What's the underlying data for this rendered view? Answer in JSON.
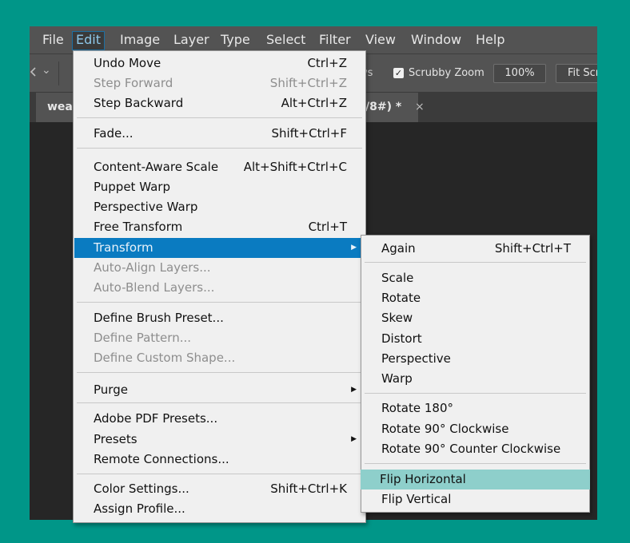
{
  "menubar": {
    "items": [
      "File",
      "Edit",
      "Image",
      "Layer",
      "Type",
      "Select",
      "Filter",
      "View",
      "Window",
      "Help"
    ],
    "active": "Edit"
  },
  "options": {
    "partial_left": "ws",
    "scrubby_zoom_label": "Scrubby Zoom",
    "scrubby_zoom_checked": true,
    "zoom_value": "100%",
    "fit_label": "Fit Scr"
  },
  "tab": {
    "title_start": "wea",
    "title_end": "/8#) *",
    "close": "×"
  },
  "edit_menu": {
    "items": [
      {
        "label": "Undo Move",
        "shortcut": "Ctrl+Z",
        "disabled": false
      },
      {
        "label": "Step Forward",
        "shortcut": "Shift+Ctrl+Z",
        "disabled": true
      },
      {
        "label": "Step Backward",
        "shortcut": "Alt+Ctrl+Z",
        "disabled": false
      },
      {
        "label": "Fade...",
        "shortcut": "Shift+Ctrl+F",
        "disabled": false
      },
      {
        "label": "Content-Aware Scale",
        "shortcut": "Alt+Shift+Ctrl+C",
        "disabled": false
      },
      {
        "label": "Puppet Warp",
        "shortcut": "",
        "disabled": false
      },
      {
        "label": "Perspective Warp",
        "shortcut": "",
        "disabled": false
      },
      {
        "label": "Free Transform",
        "shortcut": "Ctrl+T",
        "disabled": false
      },
      {
        "label": "Transform",
        "shortcut": "",
        "disabled": false,
        "submenu": true
      },
      {
        "label": "Auto-Align Layers...",
        "shortcut": "",
        "disabled": true
      },
      {
        "label": "Auto-Blend Layers...",
        "shortcut": "",
        "disabled": true
      },
      {
        "label": "Define Brush Preset...",
        "shortcut": "",
        "disabled": false
      },
      {
        "label": "Define Pattern...",
        "shortcut": "",
        "disabled": true
      },
      {
        "label": "Define Custom Shape...",
        "shortcut": "",
        "disabled": true
      },
      {
        "label": "Purge",
        "shortcut": "",
        "disabled": false,
        "submenu": true
      },
      {
        "label": "Adobe PDF Presets...",
        "shortcut": "",
        "disabled": false
      },
      {
        "label": "Presets",
        "shortcut": "",
        "disabled": false,
        "submenu": true
      },
      {
        "label": "Remote Connections...",
        "shortcut": "",
        "disabled": false
      },
      {
        "label": "Color Settings...",
        "shortcut": "Shift+Ctrl+K",
        "disabled": false
      },
      {
        "label": "Assign Profile...",
        "shortcut": "",
        "disabled": false
      }
    ],
    "highlighted": "Transform"
  },
  "transform_menu": {
    "items": [
      {
        "label": "Again",
        "shortcut": "Shift+Ctrl+T"
      },
      {
        "label": "Scale",
        "shortcut": ""
      },
      {
        "label": "Rotate",
        "shortcut": ""
      },
      {
        "label": "Skew",
        "shortcut": ""
      },
      {
        "label": "Distort",
        "shortcut": ""
      },
      {
        "label": "Perspective",
        "shortcut": ""
      },
      {
        "label": "Warp",
        "shortcut": ""
      },
      {
        "label": "Rotate 180°",
        "shortcut": ""
      },
      {
        "label": "Rotate 90° Clockwise",
        "shortcut": ""
      },
      {
        "label": "Rotate 90° Counter Clockwise",
        "shortcut": ""
      },
      {
        "label": "Flip Horizontal",
        "shortcut": ""
      },
      {
        "label": "Flip Vertical",
        "shortcut": ""
      }
    ],
    "highlighted": "Flip Horizontal"
  },
  "icons": {
    "submenu_arrow": "▶",
    "checkmark": "✓",
    "tool_chevron": "⌄"
  },
  "colors": {
    "background": "#009688",
    "menu_highlight": "#0a7bc1",
    "submenu_highlight": "#8ecfcb"
  }
}
